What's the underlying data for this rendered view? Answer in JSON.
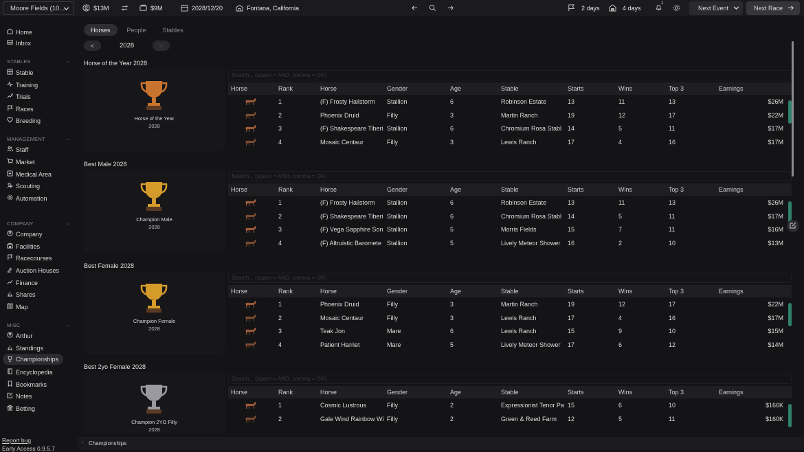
{
  "topbar": {
    "stable_selector": "Moore Fields (10...",
    "money1": "$13M",
    "money2": "$9M",
    "date": "2028/12/20",
    "location": "Fontana, California",
    "flag_days": "2 days",
    "home_days": "4 days",
    "notification_count": "1",
    "next_event": "Next Event",
    "next_race": "Next Race"
  },
  "sidebar": {
    "top_items": [
      "Home",
      "Inbox"
    ],
    "sections": [
      {
        "header": "STABLES",
        "items": [
          "Stable",
          "Training",
          "Trials",
          "Races",
          "Breeding"
        ]
      },
      {
        "header": "MANAGEMENT",
        "items": [
          "Staff",
          "Market",
          "Medical Area",
          "Scouting",
          "Automation"
        ]
      },
      {
        "header": "COMPANY",
        "items": [
          "Company",
          "Facilities",
          "Racecourses",
          "Auction Houses",
          "Finance",
          "Shares",
          "Map"
        ]
      },
      {
        "header": "MISC",
        "items": [
          "Arthur",
          "Standings",
          "Championships",
          "Encyclopedia",
          "Bookmarks",
          "Notes",
          "Betting"
        ]
      }
    ],
    "active_item": "Championships",
    "report_bug": "Report bug",
    "version": "Early Access 0.9.5.7"
  },
  "tabs": [
    "Horses",
    "People",
    "Stables"
  ],
  "active_tab": "Horses",
  "year_nav": {
    "prev": "<",
    "year": "2028",
    "next": ">"
  },
  "search_placeholder": "Search... (space = AND, comma = OR)",
  "columns": [
    "Horse",
    "Rank",
    "Horse",
    "Gender",
    "Age",
    "Stable",
    "Starts",
    "Wins",
    "Top 3",
    "Earnings"
  ],
  "sections": [
    {
      "title": "Horse of the Year 2028",
      "trophy_name": "Horse of the Year",
      "trophy_year": "2028",
      "trophy_color": "#c8742e",
      "rows": [
        {
          "rank": "1",
          "horse": "(F) Frosty Hailstorm",
          "gender": "Stallion",
          "age": "6",
          "stable": "Robinson Estate",
          "starts": "13",
          "wins": "11",
          "top3": "13",
          "earnings": "$26M"
        },
        {
          "rank": "2",
          "horse": "Phoenix Druid",
          "gender": "Filly",
          "age": "3",
          "stable": "Martin Ranch",
          "starts": "19",
          "wins": "12",
          "top3": "17",
          "earnings": "$22M"
        },
        {
          "rank": "3",
          "horse": "(F) Shakespeare Tiberi",
          "gender": "Stallion",
          "age": "6",
          "stable": "Chromium Rosa Stabl",
          "starts": "14",
          "wins": "5",
          "top3": "11",
          "earnings": "$17M"
        },
        {
          "rank": "4",
          "horse": "Mosaic Centaur",
          "gender": "Filly",
          "age": "3",
          "stable": "Lewis Ranch",
          "starts": "17",
          "wins": "4",
          "top3": "16",
          "earnings": "$17M"
        }
      ]
    },
    {
      "title": "Best Male 2028",
      "trophy_name": "Champion Male",
      "trophy_year": "2028",
      "trophy_color": "#d49a2a",
      "rows": [
        {
          "rank": "1",
          "horse": "(F) Frosty Hailstorm",
          "gender": "Stallion",
          "age": "6",
          "stable": "Robinson Estate",
          "starts": "13",
          "wins": "11",
          "top3": "13",
          "earnings": "$26M"
        },
        {
          "rank": "2",
          "horse": "(F) Shakespeare Tiberi",
          "gender": "Stallion",
          "age": "6",
          "stable": "Chromium Rosa Stabl",
          "starts": "14",
          "wins": "5",
          "top3": "11",
          "earnings": "$17M"
        },
        {
          "rank": "3",
          "horse": "(F) Vega Sapphire Son",
          "gender": "Stallion",
          "age": "5",
          "stable": "Morris Fields",
          "starts": "15",
          "wins": "7",
          "top3": "11",
          "earnings": "$16M"
        },
        {
          "rank": "4",
          "horse": "(F) Altruistic Baromete",
          "gender": "Stallion",
          "age": "5",
          "stable": "Lively Meteor Shower",
          "starts": "16",
          "wins": "2",
          "top3": "10",
          "earnings": "$13M"
        }
      ]
    },
    {
      "title": "Best Female 2028",
      "trophy_name": "Champion Female",
      "trophy_year": "2028",
      "trophy_color": "#d49a2a",
      "rows": [
        {
          "rank": "1",
          "horse": "Phoenix Druid",
          "gender": "Filly",
          "age": "3",
          "stable": "Martin Ranch",
          "starts": "19",
          "wins": "12",
          "top3": "17",
          "earnings": "$22M"
        },
        {
          "rank": "2",
          "horse": "Mosaic Centaur",
          "gender": "Filly",
          "age": "3",
          "stable": "Lewis Ranch",
          "starts": "17",
          "wins": "4",
          "top3": "16",
          "earnings": "$17M"
        },
        {
          "rank": "3",
          "horse": "Teak Jon",
          "gender": "Mare",
          "age": "6",
          "stable": "Lewis Ranch",
          "starts": "15",
          "wins": "9",
          "top3": "10",
          "earnings": "$15M"
        },
        {
          "rank": "4",
          "horse": "Patient Harriet",
          "gender": "Mare",
          "age": "5",
          "stable": "Lively Meteor Shower",
          "starts": "17",
          "wins": "6",
          "top3": "12",
          "earnings": "$14M"
        }
      ]
    },
    {
      "title": "Best 2yo Female 2028",
      "trophy_name": "Champion 2YO Filly",
      "trophy_year": "2028",
      "trophy_color": "#9a9aa0",
      "rows": [
        {
          "rank": "1",
          "horse": "Cosmic Lustrous",
          "gender": "Filly",
          "age": "2",
          "stable": "Expressionist Tenor Pa",
          "starts": "15",
          "wins": "6",
          "top3": "10",
          "earnings": "$166K"
        },
        {
          "rank": "2",
          "horse": "Gale Wind Rainbow Wi",
          "gender": "Filly",
          "age": "2",
          "stable": "Green & Reed Farm",
          "starts": "12",
          "wins": "5",
          "top3": "11",
          "earnings": "$160K"
        }
      ]
    }
  ],
  "statusbar": {
    "breadcrumb": "Championships"
  }
}
